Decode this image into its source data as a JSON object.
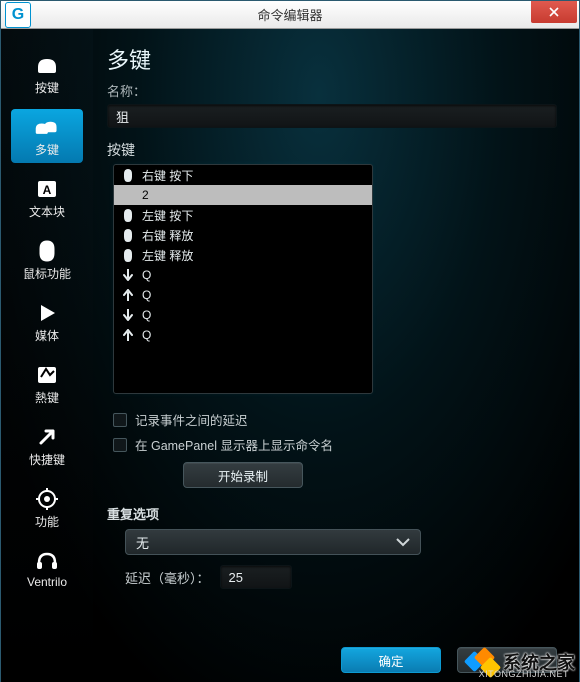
{
  "window": {
    "title": "命令编辑器",
    "logo_letter": "G"
  },
  "sidebar": {
    "items": [
      {
        "id": "keystroke",
        "label": "按键"
      },
      {
        "id": "multikey",
        "label": "多键"
      },
      {
        "id": "textblock",
        "label": "文本块"
      },
      {
        "id": "mouse",
        "label": "鼠标功能"
      },
      {
        "id": "media",
        "label": "媒体"
      },
      {
        "id": "hotkey",
        "label": "熱键"
      },
      {
        "id": "shortcut",
        "label": "快捷键"
      },
      {
        "id": "function",
        "label": "功能"
      },
      {
        "id": "ventrilo",
        "label": "Ventrilo"
      }
    ],
    "selected_index": 1
  },
  "main": {
    "heading": "多键",
    "name_label": "名称：",
    "name_value": "狙",
    "keystrokes_label": "按键",
    "recorded": [
      {
        "icon": "mouse",
        "text": "右键 按下"
      },
      {
        "icon": "edit",
        "text": "2"
      },
      {
        "icon": "mouse",
        "text": "左键 按下"
      },
      {
        "icon": "mouse",
        "text": "右键 释放"
      },
      {
        "icon": "mouse",
        "text": "左键 释放"
      },
      {
        "icon": "down",
        "text": "Q"
      },
      {
        "icon": "up",
        "text": "Q"
      },
      {
        "icon": "down",
        "text": "Q"
      },
      {
        "icon": "up",
        "text": "Q"
      }
    ],
    "recorded_selected_index": 1,
    "checkbox_delay_label": "记录事件之间的延迟",
    "checkbox_gamepanel_label": "在 GamePanel 显示器上显示命令名",
    "start_recording_label": "开始录制",
    "repeat_section_label": "重复选项",
    "repeat_select_value": "无",
    "delay_label": "延迟（毫秒）：",
    "delay_value": "25",
    "ok_label": "确定",
    "cancel_label": ""
  },
  "watermark": {
    "text": "系统之家",
    "sub": "XITONGZHIJIA.NET"
  }
}
